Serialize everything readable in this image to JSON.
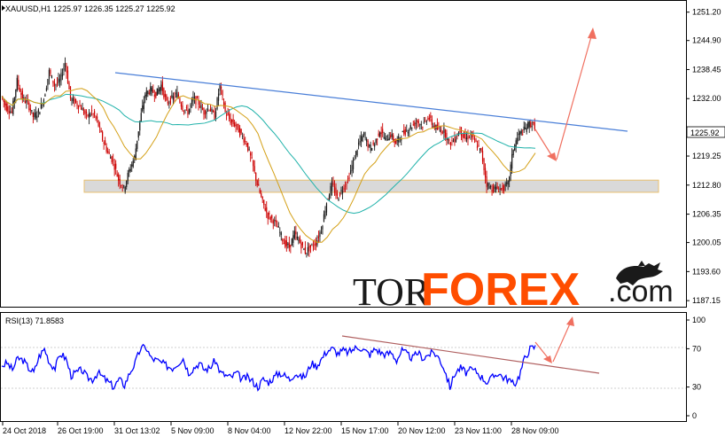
{
  "main_chart": {
    "title": "XAUUSD,H1  1225.97  1226.35  1225.27  1225.92",
    "price_badge": "1225.92",
    "price_badge_value": 1225.92,
    "y_ticks": [
      1251.2,
      1244.9,
      1238.45,
      1232.0,
      1225.92,
      1219.25,
      1212.8,
      1206.35,
      1200.05,
      1193.6,
      1187.15
    ],
    "y_tick_labels": [
      "1251.20",
      "1244.90",
      "1238.45",
      "1232.00",
      "1225.92",
      "1219.25",
      "1212.80",
      "1206.35",
      "1200.05",
      "1193.60",
      "1187.15"
    ],
    "ylim": [
      1185.8,
      1253.5
    ],
    "support_zone": [
      1211.2,
      1213.9
    ],
    "colors": {
      "bull": "#1a1a1a",
      "bear": "#cc0000",
      "ma_fast": "#d4a017",
      "ma_slow": "#20b2aa",
      "trendline": "#4a7fd8",
      "arrow": "#f07060",
      "zone": "#d9d9d9",
      "zone_border": "#e8c070"
    }
  },
  "rsi_chart": {
    "title": "RSI(13) 71.8583",
    "y_ticks": [
      100,
      70,
      30,
      0
    ],
    "y_tick_labels": [
      "100",
      "70",
      "30",
      "0"
    ],
    "ylim": [
      0,
      100
    ],
    "line_color": "#0000ff",
    "trendline_color": "#b06060"
  },
  "x_axis_labels": [
    "24 Oct 2018",
    "26 Oct 19:00",
    "31 Oct 13:02",
    "5 Nov 09:00",
    "8 Nov 04:00",
    "12 Nov 22:00",
    "15 Nov 17:00",
    "20 Nov 12:00",
    "23 Nov 11:00",
    "28 Nov 09:00"
  ],
  "watermark": {
    "tor": "TOR",
    "forex": "FOREX",
    "com": ".com"
  },
  "chart_data": [
    {
      "type": "line",
      "title": "XAUUSD,H1",
      "x": [
        0,
        6,
        12,
        18,
        24,
        30,
        36,
        42,
        48,
        54,
        60,
        66,
        72,
        78,
        84,
        90,
        96,
        102,
        108,
        114,
        120,
        126,
        132,
        138,
        144,
        150,
        156,
        162,
        168,
        174,
        180,
        186,
        192,
        198,
        204,
        210,
        216,
        222,
        228,
        234,
        240,
        246,
        252,
        258,
        264,
        270,
        276,
        282,
        288,
        294,
        300,
        306,
        312,
        318,
        324,
        330,
        336,
        342,
        348,
        354,
        360,
        366,
        372,
        378,
        384,
        390,
        396,
        402,
        408,
        414,
        420,
        426,
        432,
        438,
        444,
        450,
        456,
        462,
        468,
        474,
        480,
        486,
        492,
        498,
        504,
        510,
        516,
        522,
        528,
        534,
        540,
        546,
        552,
        558,
        564,
        570,
        576,
        582,
        588,
        594,
        600
      ],
      "series": [
        {
          "name": "",
          "values": [
            1232.5,
            1230.0,
            1229.0,
            1236.0,
            1232.0,
            1231.0,
            1228.0,
            1229.0,
            1232.0,
            1238.0,
            1235.0,
            1236.0,
            1240.0,
            1232.0,
            1231.0,
            1230.0,
            1228.0,
            1229.0,
            1227.0,
            1223.0,
            1220.0,
            1218.0,
            1214.0,
            1212.0,
            1216.0,
            1219.0,
            1227.0,
            1233.0,
            1234.0,
            1233.0,
            1235.0,
            1231.0,
            1232.0,
            1233.0,
            1230.0,
            1229.0,
            1232.0,
            1231.0,
            1229.0,
            1230.0,
            1228.0,
            1235.0,
            1229.0,
            1227.0,
            1226.0,
            1224.0,
            1222.0,
            1218.0,
            1213.0,
            1209.0,
            1206.0,
            1205.0,
            1203.0,
            1200.0,
            1199.0,
            1202.0,
            1200.0,
            1198.0,
            1199.0,
            1200.0,
            1203.0,
            1209.0,
            1213.0,
            1210.0,
            1212.0,
            1214.0,
            1218.0,
            1222.0,
            1224.0,
            1221.0,
            1222.0,
            1225.0,
            1223.0,
            1224.0,
            1222.0,
            1224.0,
            1225.0,
            1226.0,
            1227.0,
            1226.0,
            1228.0,
            1226.0,
            1225.0,
            1225.0,
            1222.0,
            1223.0,
            1225.0,
            1223.0,
            1224.0,
            1222.0,
            1220.0,
            1213.0,
            1212.0,
            1212.0,
            1212.0,
            1213.0,
            1221.0,
            1224.0,
            1225.0,
            1226.5,
            1225.92
          ]
        }
      ]
    },
    {
      "type": "line",
      "title": "RSI(13)",
      "x": [
        0,
        6,
        12,
        18,
        24,
        30,
        36,
        42,
        48,
        54,
        60,
        66,
        72,
        78,
        84,
        90,
        96,
        102,
        108,
        114,
        120,
        126,
        132,
        138,
        144,
        150,
        156,
        162,
        168,
        174,
        180,
        186,
        192,
        198,
        204,
        210,
        216,
        222,
        228,
        234,
        240,
        246,
        252,
        258,
        264,
        270,
        276,
        282,
        288,
        294,
        300,
        306,
        312,
        318,
        324,
        330,
        336,
        342,
        348,
        354,
        360,
        366,
        372,
        378,
        384,
        390,
        396,
        402,
        408,
        414,
        420,
        426,
        432,
        438,
        444,
        450,
        456,
        462,
        468,
        474,
        480,
        486,
        492,
        498,
        504,
        510,
        516,
        522,
        528,
        534,
        540,
        546,
        552,
        558,
        564,
        570,
        576,
        582,
        588,
        594,
        600
      ],
      "series": [
        {
          "name": "",
          "values": [
            52,
            55,
            48,
            60,
            58,
            50,
            45,
            62,
            70,
            55,
            50,
            65,
            60,
            42,
            45,
            48,
            40,
            38,
            45,
            40,
            35,
            30,
            38,
            32,
            45,
            55,
            70,
            72,
            60,
            58,
            55,
            52,
            50,
            55,
            60,
            45,
            50,
            55,
            48,
            50,
            58,
            45,
            42,
            40,
            45,
            38,
            40,
            36,
            30,
            38,
            35,
            40,
            45,
            42,
            38,
            45,
            40,
            42,
            55,
            52,
            60,
            68,
            70,
            65,
            68,
            66,
            70,
            72,
            68,
            64,
            70,
            66,
            64,
            66,
            58,
            68,
            64,
            60,
            66,
            60,
            64,
            66,
            60,
            48,
            30,
            45,
            50,
            45,
            48,
            46,
            40,
            35,
            40,
            45,
            40,
            38,
            32,
            42,
            60,
            70,
            71.86
          ]
        }
      ]
    }
  ]
}
